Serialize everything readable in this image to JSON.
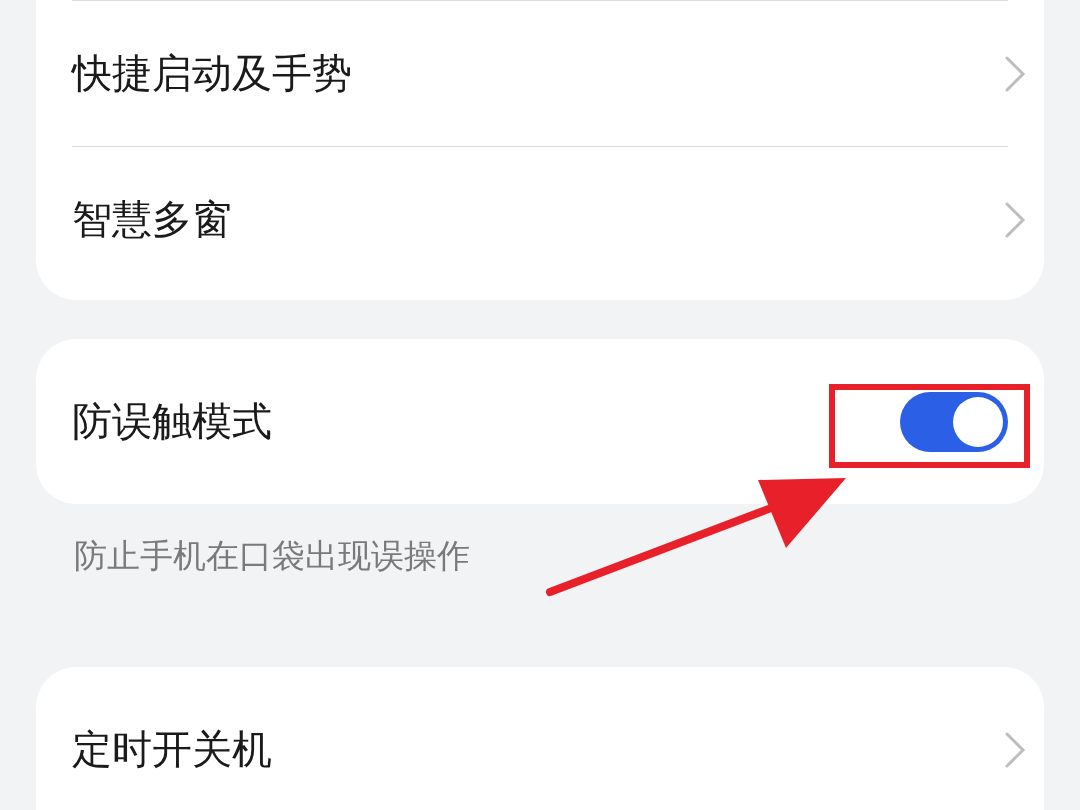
{
  "groups": [
    {
      "items": [
        {
          "kind": "link",
          "label": "快捷启动及手势"
        },
        {
          "kind": "link",
          "label": "智慧多窗"
        }
      ]
    },
    {
      "items": [
        {
          "kind": "toggle",
          "label": "防误触模式",
          "on": true
        }
      ],
      "note": "防止手机在口袋出现误操作"
    },
    {
      "items": [
        {
          "kind": "link",
          "label": "定时开关机"
        }
      ]
    }
  ]
}
